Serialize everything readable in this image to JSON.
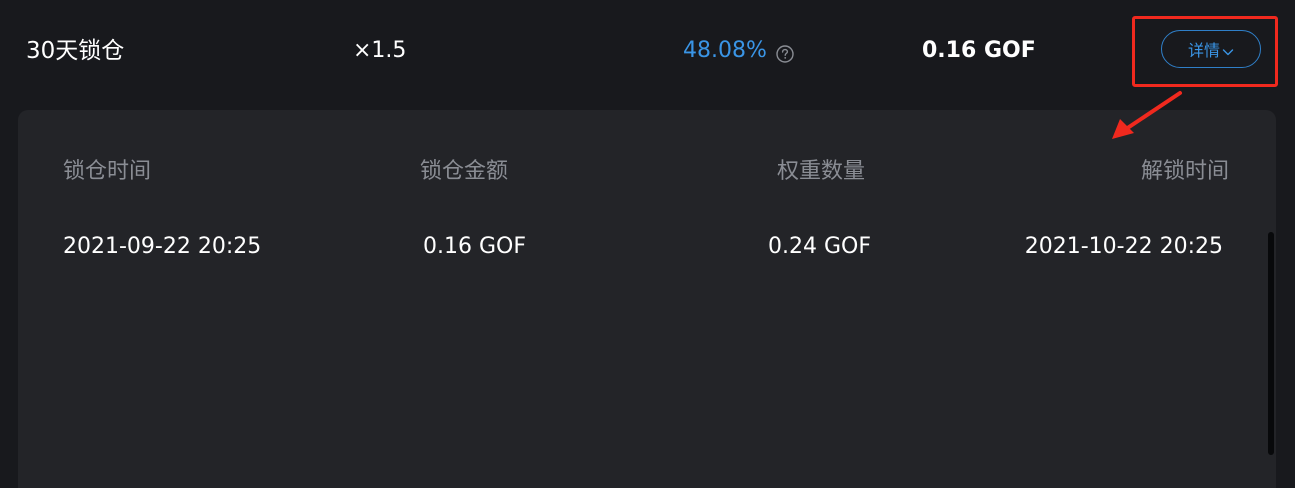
{
  "summary": {
    "lock_name": "30天锁仓",
    "multiplier": "×1.5",
    "apr": "48.08%",
    "amount": "0.16 GOF",
    "details_label": "详情"
  },
  "detail_table": {
    "headers": [
      "锁仓时间",
      "锁仓金额",
      "权重数量",
      "解锁时间"
    ],
    "rows": [
      [
        "2021-09-22 20:25",
        "0.16 GOF",
        "0.24 GOF",
        "2021-10-22 20:25"
      ]
    ]
  },
  "colors": {
    "accent": "#3a95e6",
    "annotation": "#f0291e",
    "background": "#18191d",
    "panel": "#232428"
  },
  "icons": {
    "help": "help-circle-icon",
    "chevron": "chevron-down-icon",
    "annotation_arrow": "annotation-arrow-icon"
  }
}
